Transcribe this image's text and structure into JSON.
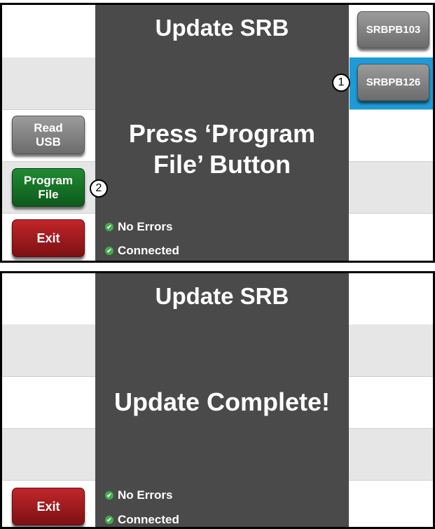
{
  "screen1": {
    "title": "Update SRB",
    "message_line1": "Press ‘Program",
    "message_line2": "File’ Button",
    "status": [
      "No Errors",
      "Connected"
    ],
    "left_buttons": {
      "read_usb": [
        "Read",
        "USB"
      ],
      "program_file": [
        "Program",
        "File"
      ],
      "exit": "Exit"
    },
    "device_list": [
      "SRBPB103",
      "SRBPB126"
    ],
    "selected_device": "SRBPB126",
    "markers": [
      "1",
      "2"
    ]
  },
  "screen2": {
    "title": "Update SRB",
    "message": "Update Complete!",
    "status": [
      "No Errors",
      "Connected"
    ],
    "exit": "Exit"
  },
  "colors": {
    "panel": "#4a4a4a",
    "selection": "#1e9bd7",
    "program_button": "#1f8a32",
    "exit_button": "#c1262a",
    "status_check": "#3fae49"
  }
}
